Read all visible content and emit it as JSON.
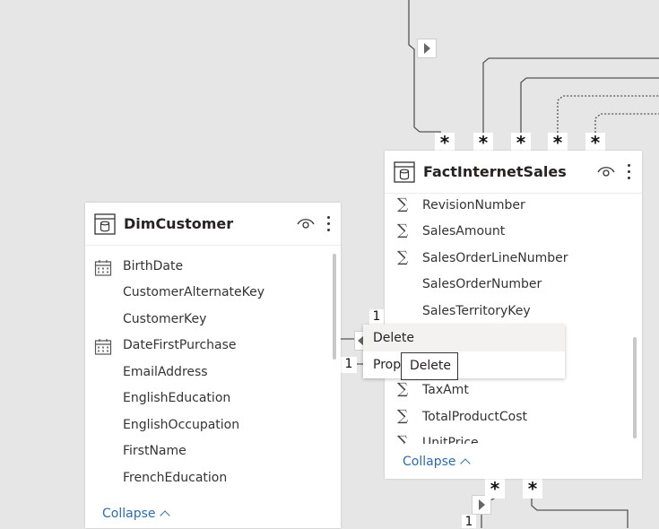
{
  "tables": {
    "fact": {
      "title": "FactInternetSales",
      "fields": [
        {
          "label": "RevisionNumber",
          "icon": "sigma-icon"
        },
        {
          "label": "SalesAmount",
          "icon": "sigma-icon"
        },
        {
          "label": "SalesOrderLineNumber",
          "icon": "sigma-icon"
        },
        {
          "label": "SalesOrderNumber",
          "icon": ""
        },
        {
          "label": "SalesTerritoryKey",
          "icon": ""
        },
        {
          "label": "TaxAmt",
          "icon": "sigma-icon"
        },
        {
          "label": "TotalProductCost",
          "icon": "sigma-icon"
        },
        {
          "label": "UnitPrice",
          "icon": "sigma-icon"
        }
      ],
      "collapse_label": "Collapse"
    },
    "customer": {
      "title": "DimCustomer",
      "fields": [
        {
          "label": "BirthDate",
          "icon": "calendar-icon"
        },
        {
          "label": "CustomerAlternateKey",
          "icon": ""
        },
        {
          "label": "CustomerKey",
          "icon": ""
        },
        {
          "label": "DateFirstPurchase",
          "icon": "calendar-icon"
        },
        {
          "label": "EmailAddress",
          "icon": ""
        },
        {
          "label": "EnglishEducation",
          "icon": ""
        },
        {
          "label": "EnglishOccupation",
          "icon": ""
        },
        {
          "label": "FirstName",
          "icon": ""
        },
        {
          "label": "FrenchEducation",
          "icon": ""
        }
      ],
      "collapse_label": "Collapse"
    }
  },
  "cardinality": {
    "many": "*",
    "one": "1"
  },
  "context_menu": {
    "items": [
      "Delete",
      "Prop"
    ]
  },
  "tooltip": {
    "text": "Delete"
  },
  "colors": {
    "canvas": "#e6e6e6",
    "link": "#2b6cb0"
  }
}
